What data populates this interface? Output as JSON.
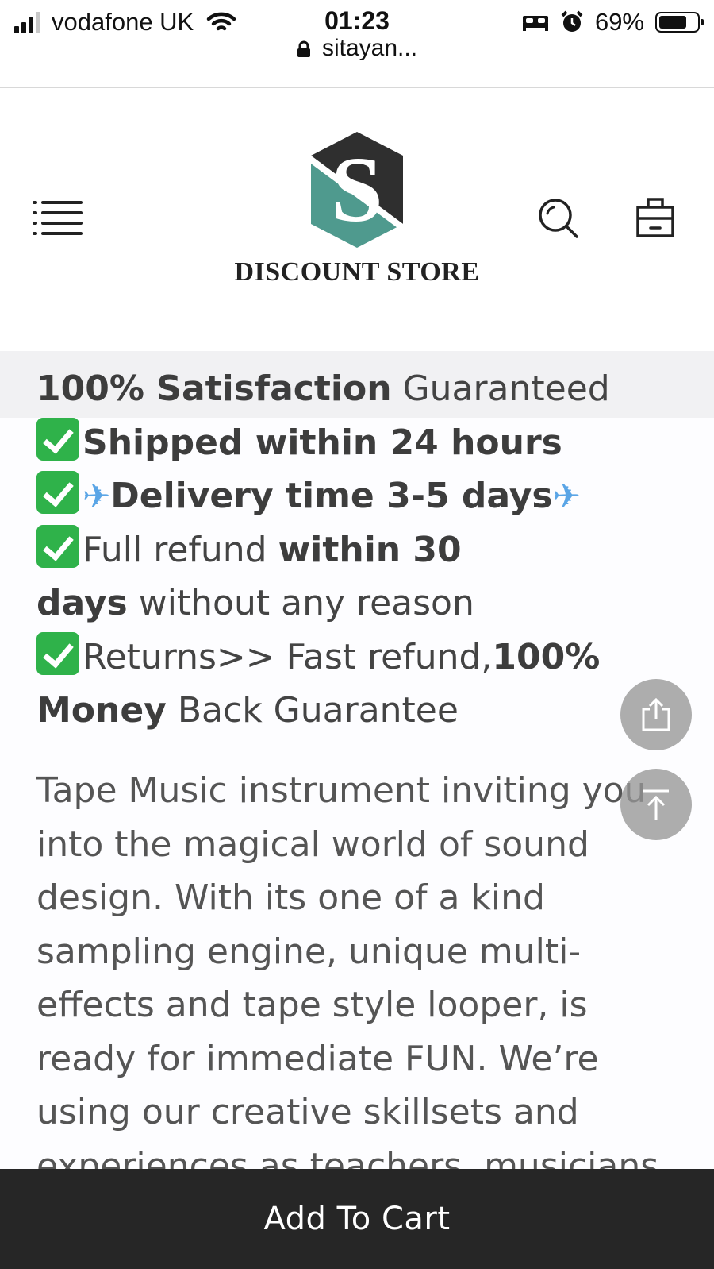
{
  "status_bar": {
    "carrier": "vodafone UK",
    "time": "01:23",
    "url": "sitayan...",
    "battery_percent": "69%",
    "battery_level": 0.69,
    "icons": [
      "signal-icon",
      "wifi-icon",
      "lock-icon",
      "bed-icon",
      "alarm-icon",
      "battery-icon"
    ]
  },
  "header": {
    "store_name": "DISCOUNT STORE",
    "logo_letter": "S",
    "icons": [
      "menu-icon",
      "search-icon",
      "shopping-bag-icon"
    ],
    "colors": {
      "logo_dark": "#2f2f2f",
      "logo_teal": "#4f9a8e"
    }
  },
  "guarantees": {
    "line1_bold": "100% Satisfaction",
    "line1_rest": " Guaranteed",
    "shipped": "Shipped within 24 hours",
    "delivery": "Delivery time 3-5 days",
    "refund_pre": "Full refund ",
    "refund_bold1": "within 30",
    "refund_bold2": "days",
    "refund_post": " without any reason",
    "returns_pre": "Returns>> Fast refund,",
    "returns_bold1": "100%",
    "returns_bold2": "Money",
    "returns_post": " Back Guarantee"
  },
  "description": "Tape Music instrument inviting you into the magical world of sound design. With its one of a kind sampling engine, unique multi-effects and tape style looper, is ready for immediate FUN. We’re using our creative skillsets and experiences as teachers, musicians",
  "floating": {
    "icons": [
      "share-icon",
      "back-to-top-icon"
    ]
  },
  "cart_bar": {
    "label": "Add To Cart",
    "background": "#262626"
  }
}
